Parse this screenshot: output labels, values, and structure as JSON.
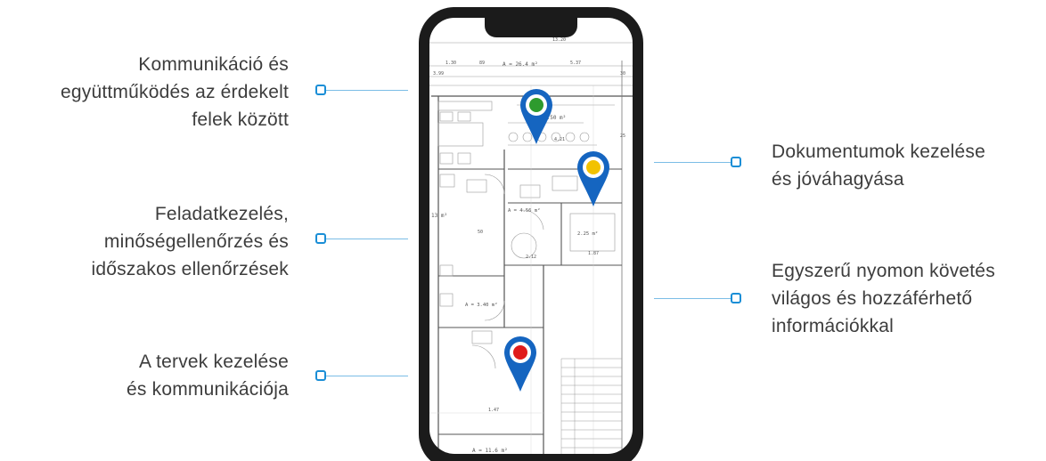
{
  "features_left": [
    {
      "lines": [
        "Kommunikáció és",
        "együttműködés az érdekelt",
        "felek között"
      ]
    },
    {
      "lines": [
        "Feladatkezelés,",
        "minőségellenőrzés és",
        "időszakos ellenőrzések"
      ]
    },
    {
      "lines": [
        "A tervek kezelése",
        "és kommunikációja"
      ]
    }
  ],
  "features_right": [
    {
      "lines": [
        "Dokumentumok kezelése",
        "és jóváhagyása"
      ]
    },
    {
      "lines": [
        "Egyszerű nyomon követés",
        "világos és hozzáférhető",
        "információkkal"
      ]
    }
  ],
  "floorplan": {
    "dims": {
      "top": "13.20",
      "a1": "1.30",
      "a2": "89",
      "a3": "5.37",
      "a4": "3.99",
      "a5": "30",
      "area_top": "A = 26.4 m²",
      "area_kitchen": "4.50 m²",
      "dim_421": "4.21",
      "area_bath": "A = 4.56 m²",
      "area_small": "2.25 m²",
      "area_hall": "A = 3.40 m²",
      "area_left": "13 m²",
      "area_bottom": "A = 11.6 m²",
      "d_147": "1.47",
      "d_187": "1.87",
      "d_212": "2.12",
      "d_50": "50",
      "d_25": "25"
    }
  },
  "pins": [
    {
      "name": "pin-green",
      "color": "#2e9b2e"
    },
    {
      "name": "pin-yellow",
      "color": "#f2c200"
    },
    {
      "name": "pin-red",
      "color": "#e01b1b"
    }
  ],
  "colors": {
    "accent": "#1a8ed6",
    "connector": "#7bbde6",
    "pin_body": "#1565c0",
    "phone_frame": "#1b1b1b"
  }
}
